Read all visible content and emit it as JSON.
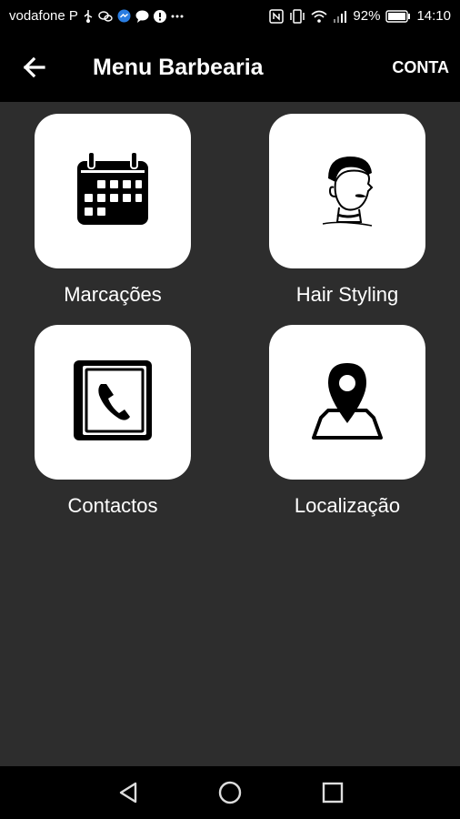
{
  "status_bar": {
    "carrier": "vodafone P",
    "battery": "92%",
    "time": "14:10",
    "icons": [
      "usb-icon",
      "wechat-icon",
      "messenger-icon",
      "chat-icon",
      "alert-icon",
      "more-icon",
      "nfc-icon",
      "vibrate-icon",
      "wifi-icon",
      "signal-icon",
      "battery-icon"
    ]
  },
  "app_bar": {
    "title": "Menu Barbearia",
    "account_label": "CONTA",
    "back_icon": "arrow-back-icon"
  },
  "menu": {
    "items": [
      {
        "label": "Marcações",
        "icon": "calendar-icon"
      },
      {
        "label": "Hair Styling",
        "icon": "barber-portrait-icon"
      },
      {
        "label": "Contactos",
        "icon": "phone-book-icon"
      },
      {
        "label": "Localização",
        "icon": "map-pin-icon"
      }
    ]
  },
  "nav_bar": {
    "icons": [
      "back-triangle-icon",
      "home-circle-icon",
      "recents-square-icon"
    ]
  },
  "colors": {
    "background": "#2d2d2d",
    "bars": "#000000",
    "tile": "#ffffff",
    "text": "#ffffff"
  }
}
